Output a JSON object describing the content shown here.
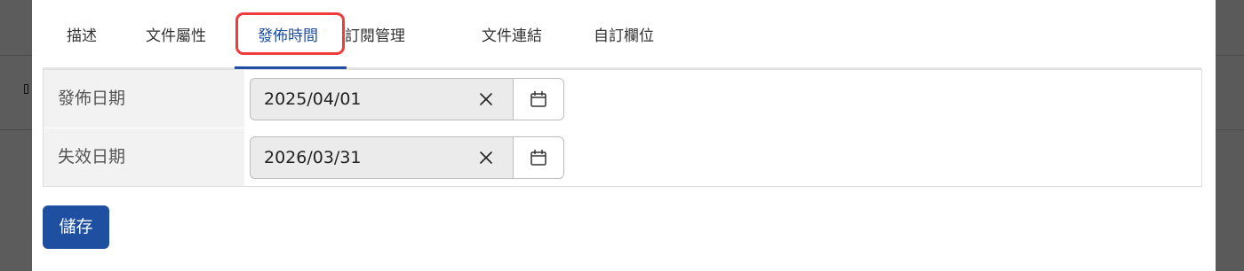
{
  "tabs": [
    {
      "label": "描述"
    },
    {
      "label": "文件屬性"
    },
    {
      "label": "發佈時間"
    },
    {
      "label": "訂閱管理"
    },
    {
      "label": "文件連結"
    },
    {
      "label": "自訂欄位"
    }
  ],
  "active_tab": "發佈時間",
  "form": {
    "publish_date": {
      "label": "發佈日期",
      "value": "2025/04/01"
    },
    "expiry_date": {
      "label": "失效日期",
      "value": "2026/03/31"
    }
  },
  "actions": {
    "save_label": "儲存"
  },
  "colors": {
    "accent": "#1f4ea3",
    "highlight_border": "#ef3b3b",
    "input_background": "#ebebeb"
  },
  "icons": {
    "clear": "close-icon",
    "calendar": "calendar-icon"
  }
}
